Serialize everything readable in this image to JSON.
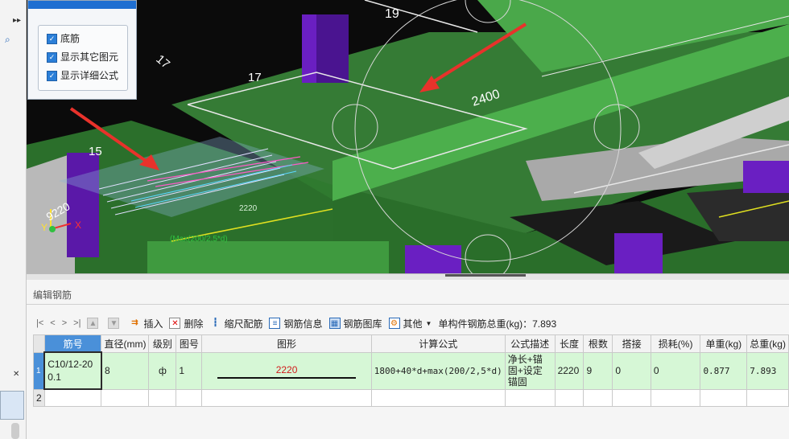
{
  "left_panel": {
    "expand_glyph": "▸▸",
    "search_icon": "search-icon"
  },
  "options_panel": {
    "checkboxes": [
      {
        "label": "底筋",
        "checked": true
      },
      {
        "label": "显示其它图元",
        "checked": true
      },
      {
        "label": "显示详细公式",
        "checked": true
      }
    ]
  },
  "viewport": {
    "labels": {
      "n19": "19",
      "n17a": "17",
      "n17b": "17",
      "n15": "15",
      "dim2400": "2400",
      "dim2220": "2220",
      "dim9220": "9220",
      "formula_hint": "(Max(200/2,5*d)",
      "axis_x": "X",
      "axis_y": "Y"
    },
    "colors": {
      "beam": "#2f8f2f",
      "column": "#6a1fc2",
      "slab": "#bdbdbd",
      "annotation_arrow": "#e8322b"
    }
  },
  "editor": {
    "title": "编辑钢筋",
    "nav": {
      "first": "|<",
      "prev": "<",
      "next": ">",
      "last": ">|"
    },
    "toolbar": {
      "insert": "插入",
      "delete": "删除",
      "scale": "缩尺配筋",
      "info": "钢筋信息",
      "library": "钢筋图库",
      "other": "其他",
      "total_label": "单构件钢筋总重(kg)：7.893"
    },
    "columns": [
      "筋号",
      "直径(mm)",
      "级别",
      "图号",
      "图形",
      "计算公式",
      "公式描述",
      "长度",
      "根数",
      "搭接",
      "损耗(%)",
      "单重(kg)",
      "总重(kg)"
    ],
    "rows": [
      {
        "index": "1",
        "bar_no": "C10/12-200.1",
        "diameter": "8",
        "grade": "ф",
        "shape_no": "1",
        "shape_value": "2220",
        "formula": "1800+40*d+max(200/2,5*d)",
        "description": "净长+锚固+设定锚固",
        "length": "2220",
        "count": "9",
        "lap": "0",
        "loss": "0",
        "unit_weight": "0.877",
        "total_weight": "7.893"
      },
      {
        "index": "2"
      }
    ]
  }
}
